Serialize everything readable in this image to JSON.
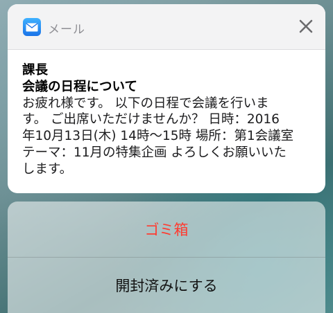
{
  "notification": {
    "app_name": "メール",
    "sender": "課長",
    "subject": "会議の日程について",
    "body_lines": [
      "お疲れ様です。 以下の日程で会議を行いま",
      "す。 ご出席いただけませんか？ 日時：2016",
      "年10月13日(木) 14時〜15時 場所：第1会議室",
      "テーマ：11月の特集企画 よろしくお願いいた",
      "します。"
    ]
  },
  "actions": {
    "trash_label": "ゴミ箱",
    "mark_read_label": "開封済みにする"
  },
  "icons": {
    "app": "mail-icon",
    "close": "close-icon"
  },
  "colors": {
    "destructive": "#ff3b30",
    "mail_icon": "#1a73e8"
  }
}
